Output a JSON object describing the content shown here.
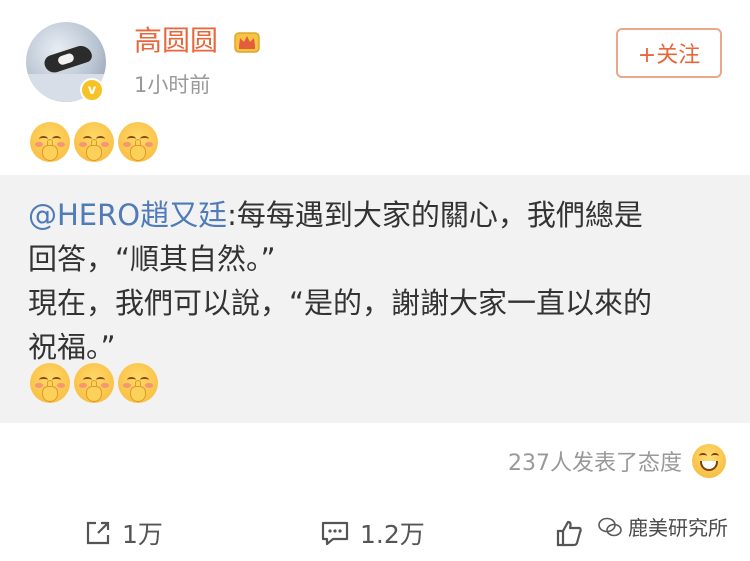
{
  "post": {
    "username": "高圆圆",
    "time": "1小时前",
    "follow_label": "+关注",
    "emojis": [
      "hush-icon",
      "hush-icon",
      "hush-icon"
    ]
  },
  "repost": {
    "mention": "@HERO趙又廷",
    "line1_rest": ":每每遇到大家的關心，我們總是",
    "line2": "回答，“順其自然。”",
    "line3": "現在，我們可以說，“是的，謝謝大家一直以來的",
    "line4": "祝福。”",
    "emojis": [
      "hush-icon",
      "hush-icon",
      "hush-icon"
    ]
  },
  "reactions": {
    "text": "237人发表了态度",
    "icon": "laugh-icon"
  },
  "actions": {
    "share_count": "1万",
    "comment_count": "1.2万"
  },
  "watermark": {
    "text": "鹿美研究所"
  },
  "colors": {
    "username": "#e8663b",
    "mention": "#4f7bb8",
    "verify_badge": "#f6c225",
    "repost_bg": "#f2f2f2"
  }
}
